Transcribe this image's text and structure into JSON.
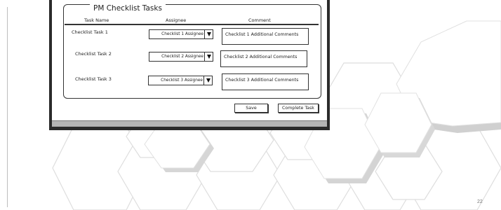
{
  "form": {
    "title": "PM Checklist Tasks",
    "columns": [
      "Task Name",
      "Assignee",
      "Comment"
    ],
    "rows": [
      {
        "task": "Checklist Task 1",
        "assignee": "Checklist 1 Assignee",
        "comment": "Checklist 1 Additional Comments"
      },
      {
        "task": "Checklist Task 2",
        "assignee": "Checklist 2 Assignee",
        "comment": "Checklist 2 Additional Comments"
      },
      {
        "task": "Checklist Task 3",
        "assignee": "Checklist 3 Assignee",
        "comment": "Checklist 3 Additional Comments"
      }
    ],
    "save_label": "Save",
    "complete_label": "Complete Task"
  },
  "slide": {
    "page_number": "22"
  },
  "dropdown_icon": "chevron-down-icon"
}
